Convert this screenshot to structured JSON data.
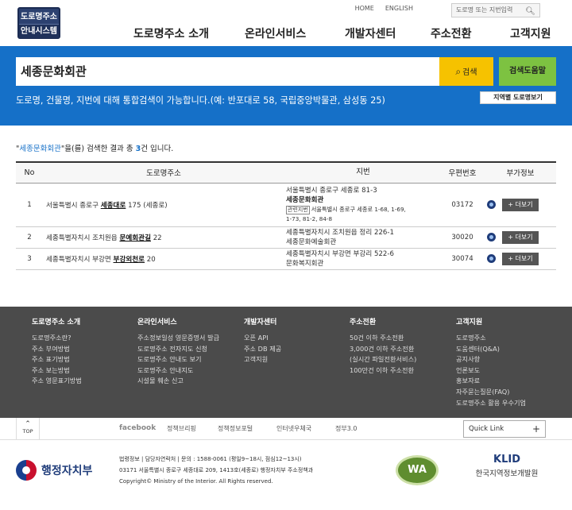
{
  "header": {
    "logo_line1": "도로명주소",
    "logo_line2": "안내시스템",
    "util_home": "HOME",
    "util_english": "ENGLISH",
    "util_search_placeholder": "도로명 또는 지번입력",
    "nav": [
      "도로명주소 소개",
      "온라인서비스",
      "개발자센터",
      "주소전환",
      "고객지원"
    ]
  },
  "search": {
    "query": "세종문화회관",
    "button_label": "검색",
    "help_label": "검색도움말",
    "hint": "도로명, 건물명, 지번에 대해 통합검색이 가능합니다.(예: 반포대로 58, 국립중앙박물관, 삼성동 25)",
    "map_button": "지역별 도로명보기"
  },
  "results": {
    "summary_prefix": "\"",
    "summary_query": "세종문화회관",
    "summary_mid": "\"을(를) 검색한 결과 총 ",
    "summary_count": "3",
    "summary_suffix": "건 입니다.",
    "columns": [
      "No",
      "도로명주소",
      "지번",
      "우편번호",
      "부가정보"
    ],
    "more_label": "+ 더보기",
    "rows": [
      {
        "no": "1",
        "road_prefix": "서울특별시 종로구 ",
        "road_street": "세종대로",
        "road_suffix": " 175 (세종로)",
        "jibun_line1": "서울특별시 종로구 세종로 81-3",
        "jibun_bldg": "세종문화회관",
        "related_tag": "관련지번",
        "related_line1": "서울특별시 종로구 세종로 1-68, 1-69,",
        "related_line2": "1-73, 81-2, 84-8",
        "zip": "03172"
      },
      {
        "no": "2",
        "road_prefix": "세종특별자치시 조치원읍 ",
        "road_street": "문예회관길",
        "road_suffix": " 22",
        "jibun_line1": "세종특별자치시 조치원읍 정리 226-1",
        "jibun_bldg": "세종문화예술회관",
        "zip": "30020"
      },
      {
        "no": "3",
        "road_prefix": "세종특별자치시 부강면 ",
        "road_street": "부강외천로",
        "road_suffix": " 20",
        "jibun_line1": "세종특별자치시 부강면 부강리 522-6",
        "jibun_bldg": "문화복지회관",
        "zip": "30074"
      }
    ]
  },
  "footer_menu": [
    {
      "title": "도로명주소 소개",
      "items": [
        "도로명주소란?",
        "주소 부여방법",
        "주소 표기방법",
        "주소 보는방법",
        "주소 영문표기방법"
      ]
    },
    {
      "title": "온라인서비스",
      "items": [
        "주소정보일성 영문증명서 발급",
        "도로명주소 전자지도 신청",
        "도로명주소 안내도 보기",
        "도로명주소 안내지도",
        "시설물 훼손 신고"
      ]
    },
    {
      "title": "개발자센터",
      "items": [
        "오픈 API",
        "주소 DB 제공",
        "고객지원"
      ]
    },
    {
      "title": "주소전환",
      "items": [
        "50건 이하 주소전환",
        "3,000건 이하 주소전환",
        "(실시간 파일전환서비스)",
        "100만건 이하 주소전환"
      ]
    },
    {
      "title": "고객지원",
      "items": [
        "도로명주소",
        "도움센터(Q&A)",
        "공지사항",
        "언론보도",
        "홍보자료",
        "자주묻는질문(FAQ)",
        "도로명주소 활용 우수기업"
      ]
    }
  ],
  "bottom_bar": {
    "top_label": "TOP",
    "links": [
      "facebook",
      "정책브리핑",
      "정책정보포털",
      "인터넷우체국",
      "정부3.0"
    ],
    "quick_link": "Quick Link"
  },
  "copyright": {
    "ministry": "행정자치부",
    "line1": "법령정보 | 담당자연락처 | 문의 : 1588-0061 (평일9~18시, 점심12~13시)",
    "line2": "03171 서울특별시 종로구 세종대로 209, 1413호(세종로) 행정자치부 주소정책과",
    "line3": "Copyright© Ministry of the Interior. All Rights reserved.",
    "wa_mark": "WA",
    "klid_logo": "KLID",
    "klid_name": "한국지역정보개발원"
  },
  "colors": {
    "primary_blue": "#1570c8",
    "search_yellow": "#f6c200",
    "help_green": "#7dc241",
    "footer_gray": "#4b4b4b"
  }
}
